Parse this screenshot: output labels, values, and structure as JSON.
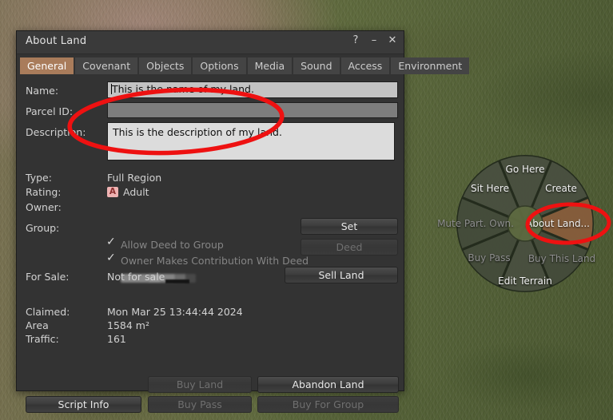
{
  "window": {
    "title": "About Land",
    "controls": [
      {
        "name": "help-button",
        "glyph": "?"
      },
      {
        "name": "minimize-button",
        "glyph": "–"
      },
      {
        "name": "close-button",
        "glyph": "✕"
      }
    ]
  },
  "tabs": [
    {
      "label": "General",
      "active": true
    },
    {
      "label": "Covenant",
      "active": false
    },
    {
      "label": "Objects",
      "active": false
    },
    {
      "label": "Options",
      "active": false
    },
    {
      "label": "Media",
      "active": false
    },
    {
      "label": "Sound",
      "active": false
    },
    {
      "label": "Access",
      "active": false
    },
    {
      "label": "Environment",
      "active": false
    }
  ],
  "general": {
    "labels": {
      "name": "Name:",
      "parcel_id": "Parcel ID:",
      "description": "Description:",
      "type": "Type:",
      "rating": "Rating:",
      "owner": "Owner:",
      "group": "Group:",
      "for_sale": "For Sale:",
      "claimed": "Claimed:",
      "area": "Area",
      "traffic": "Traffic:"
    },
    "name_value": "This is the name of my land.",
    "parcel_id_value": "",
    "description_value": "This is the description of my land.",
    "type_value": "Full Region",
    "rating_badge": "A",
    "rating_value": "Adult",
    "owner_value": "",
    "for_sale_value": "Not for sale",
    "claimed_value": "Mon Mar 25 13:44:44 2024",
    "area_value": "1584 m²",
    "traffic_value": "161",
    "checkboxes": [
      {
        "label": "Allow Deed to Group",
        "checked": true,
        "enabled": false
      },
      {
        "label": "Owner Makes Contribution With Deed",
        "checked": true,
        "enabled": false
      }
    ],
    "buttons": {
      "set": {
        "label": "Set",
        "enabled": true
      },
      "deed": {
        "label": "Deed",
        "enabled": false
      },
      "sell_land": {
        "label": "Sell Land",
        "enabled": true
      },
      "buy_land": {
        "label": "Buy Land",
        "enabled": false
      },
      "abandon_land": {
        "label": "Abandon Land",
        "enabled": true
      },
      "script_info": {
        "label": "Script Info",
        "enabled": true
      },
      "buy_pass": {
        "label": "Buy Pass",
        "enabled": false
      },
      "buy_for_group": {
        "label": "Buy For Group",
        "enabled": false
      }
    }
  },
  "pie_menu": {
    "items": [
      {
        "label": "Go Here",
        "enabled": true,
        "highlighted": false
      },
      {
        "label": "Create",
        "enabled": true,
        "highlighted": false
      },
      {
        "label": "About Land...",
        "enabled": true,
        "highlighted": true
      },
      {
        "label": "Buy This Land",
        "enabled": false,
        "highlighted": false
      },
      {
        "label": "Edit Terrain",
        "enabled": true,
        "highlighted": false
      },
      {
        "label": "Buy Pass",
        "enabled": false,
        "highlighted": false
      },
      {
        "label": "Mute Part. Own.",
        "enabled": false,
        "highlighted": false
      },
      {
        "label": "Sit Here",
        "enabled": true,
        "highlighted": false
      }
    ]
  },
  "annotations": [
    {
      "name": "annotation-ellipse-parcel-fields",
      "color": "#ee1111"
    },
    {
      "name": "annotation-ellipse-about-land-slice",
      "color": "#ee1111"
    }
  ],
  "colors": {
    "accent_tab": "#a97c5b",
    "annotation_red": "#ee1111",
    "pie_highlight": "#8a5f3c",
    "rating_badge_bg": "#efb3b3"
  }
}
